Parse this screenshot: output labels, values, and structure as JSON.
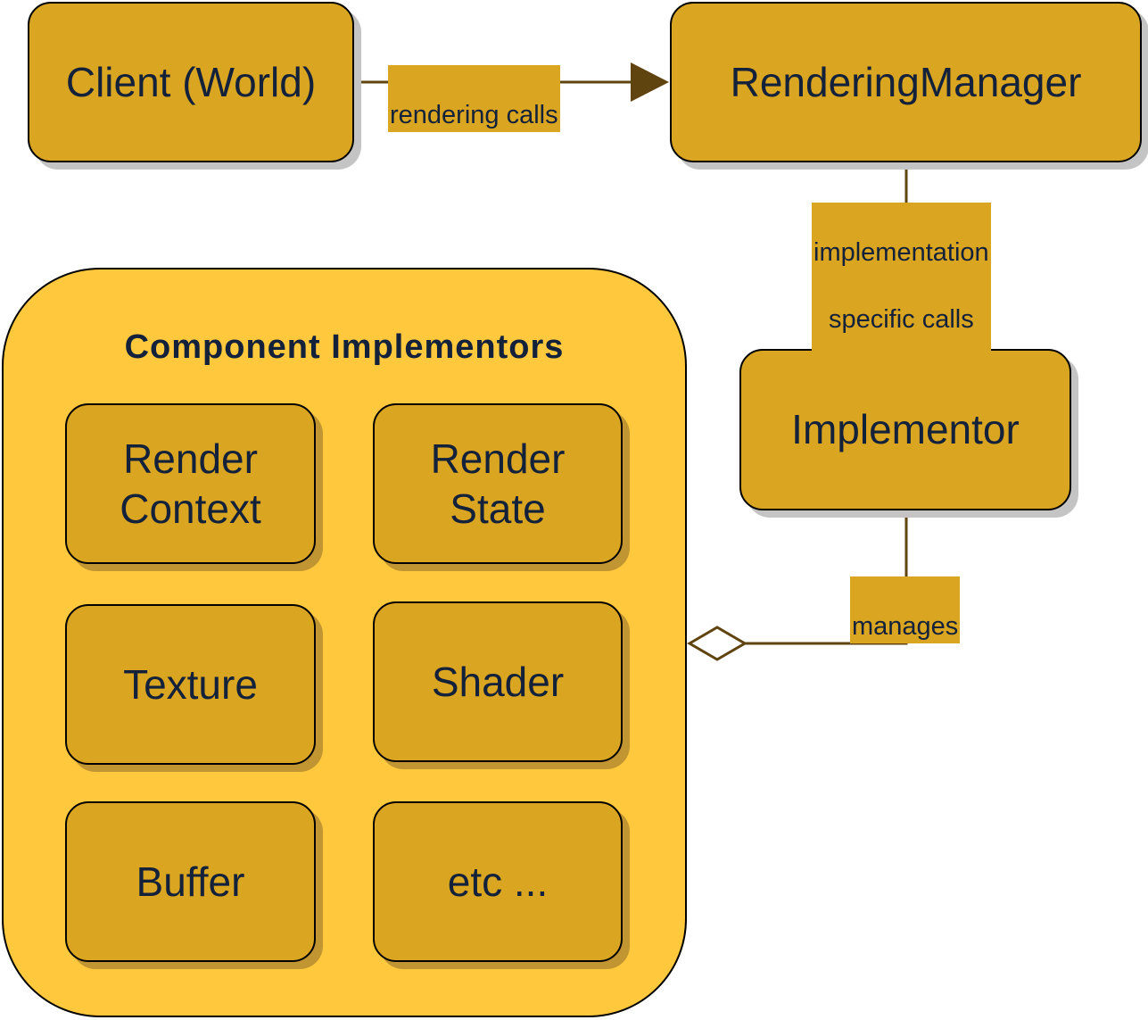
{
  "diagram": {
    "nodes": {
      "client": {
        "label": "Client (World)"
      },
      "rendering_manager": {
        "label": "RenderingManager"
      },
      "implementor": {
        "label": "Implementor"
      }
    },
    "group": {
      "title": "Component Implementors",
      "items": [
        {
          "line1": "Render",
          "line2": "Context"
        },
        {
          "line1": "Render",
          "line2": "State"
        },
        {
          "line1": "Texture",
          "line2": ""
        },
        {
          "line1": "Shader",
          "line2": ""
        },
        {
          "line1": "Buffer",
          "line2": ""
        },
        {
          "line1": "etc ...",
          "line2": ""
        }
      ]
    },
    "edges": [
      {
        "from": "Client (World)",
        "to": "RenderingManager",
        "label": "rendering calls",
        "arrow": "filled-triangle"
      },
      {
        "from": "RenderingManager",
        "to": "Implementor",
        "label_line1": "implementation",
        "label_line2": "specific calls",
        "arrow": "filled-triangle"
      },
      {
        "from": "Implementor",
        "to": "Component Implementors",
        "label": "manages",
        "arrow": "hollow-diamond"
      }
    ],
    "colors": {
      "node_fill": "#daa520",
      "group_fill": "#ffc83d",
      "edge_color": "#60440f",
      "text_color": "#13213a"
    }
  }
}
